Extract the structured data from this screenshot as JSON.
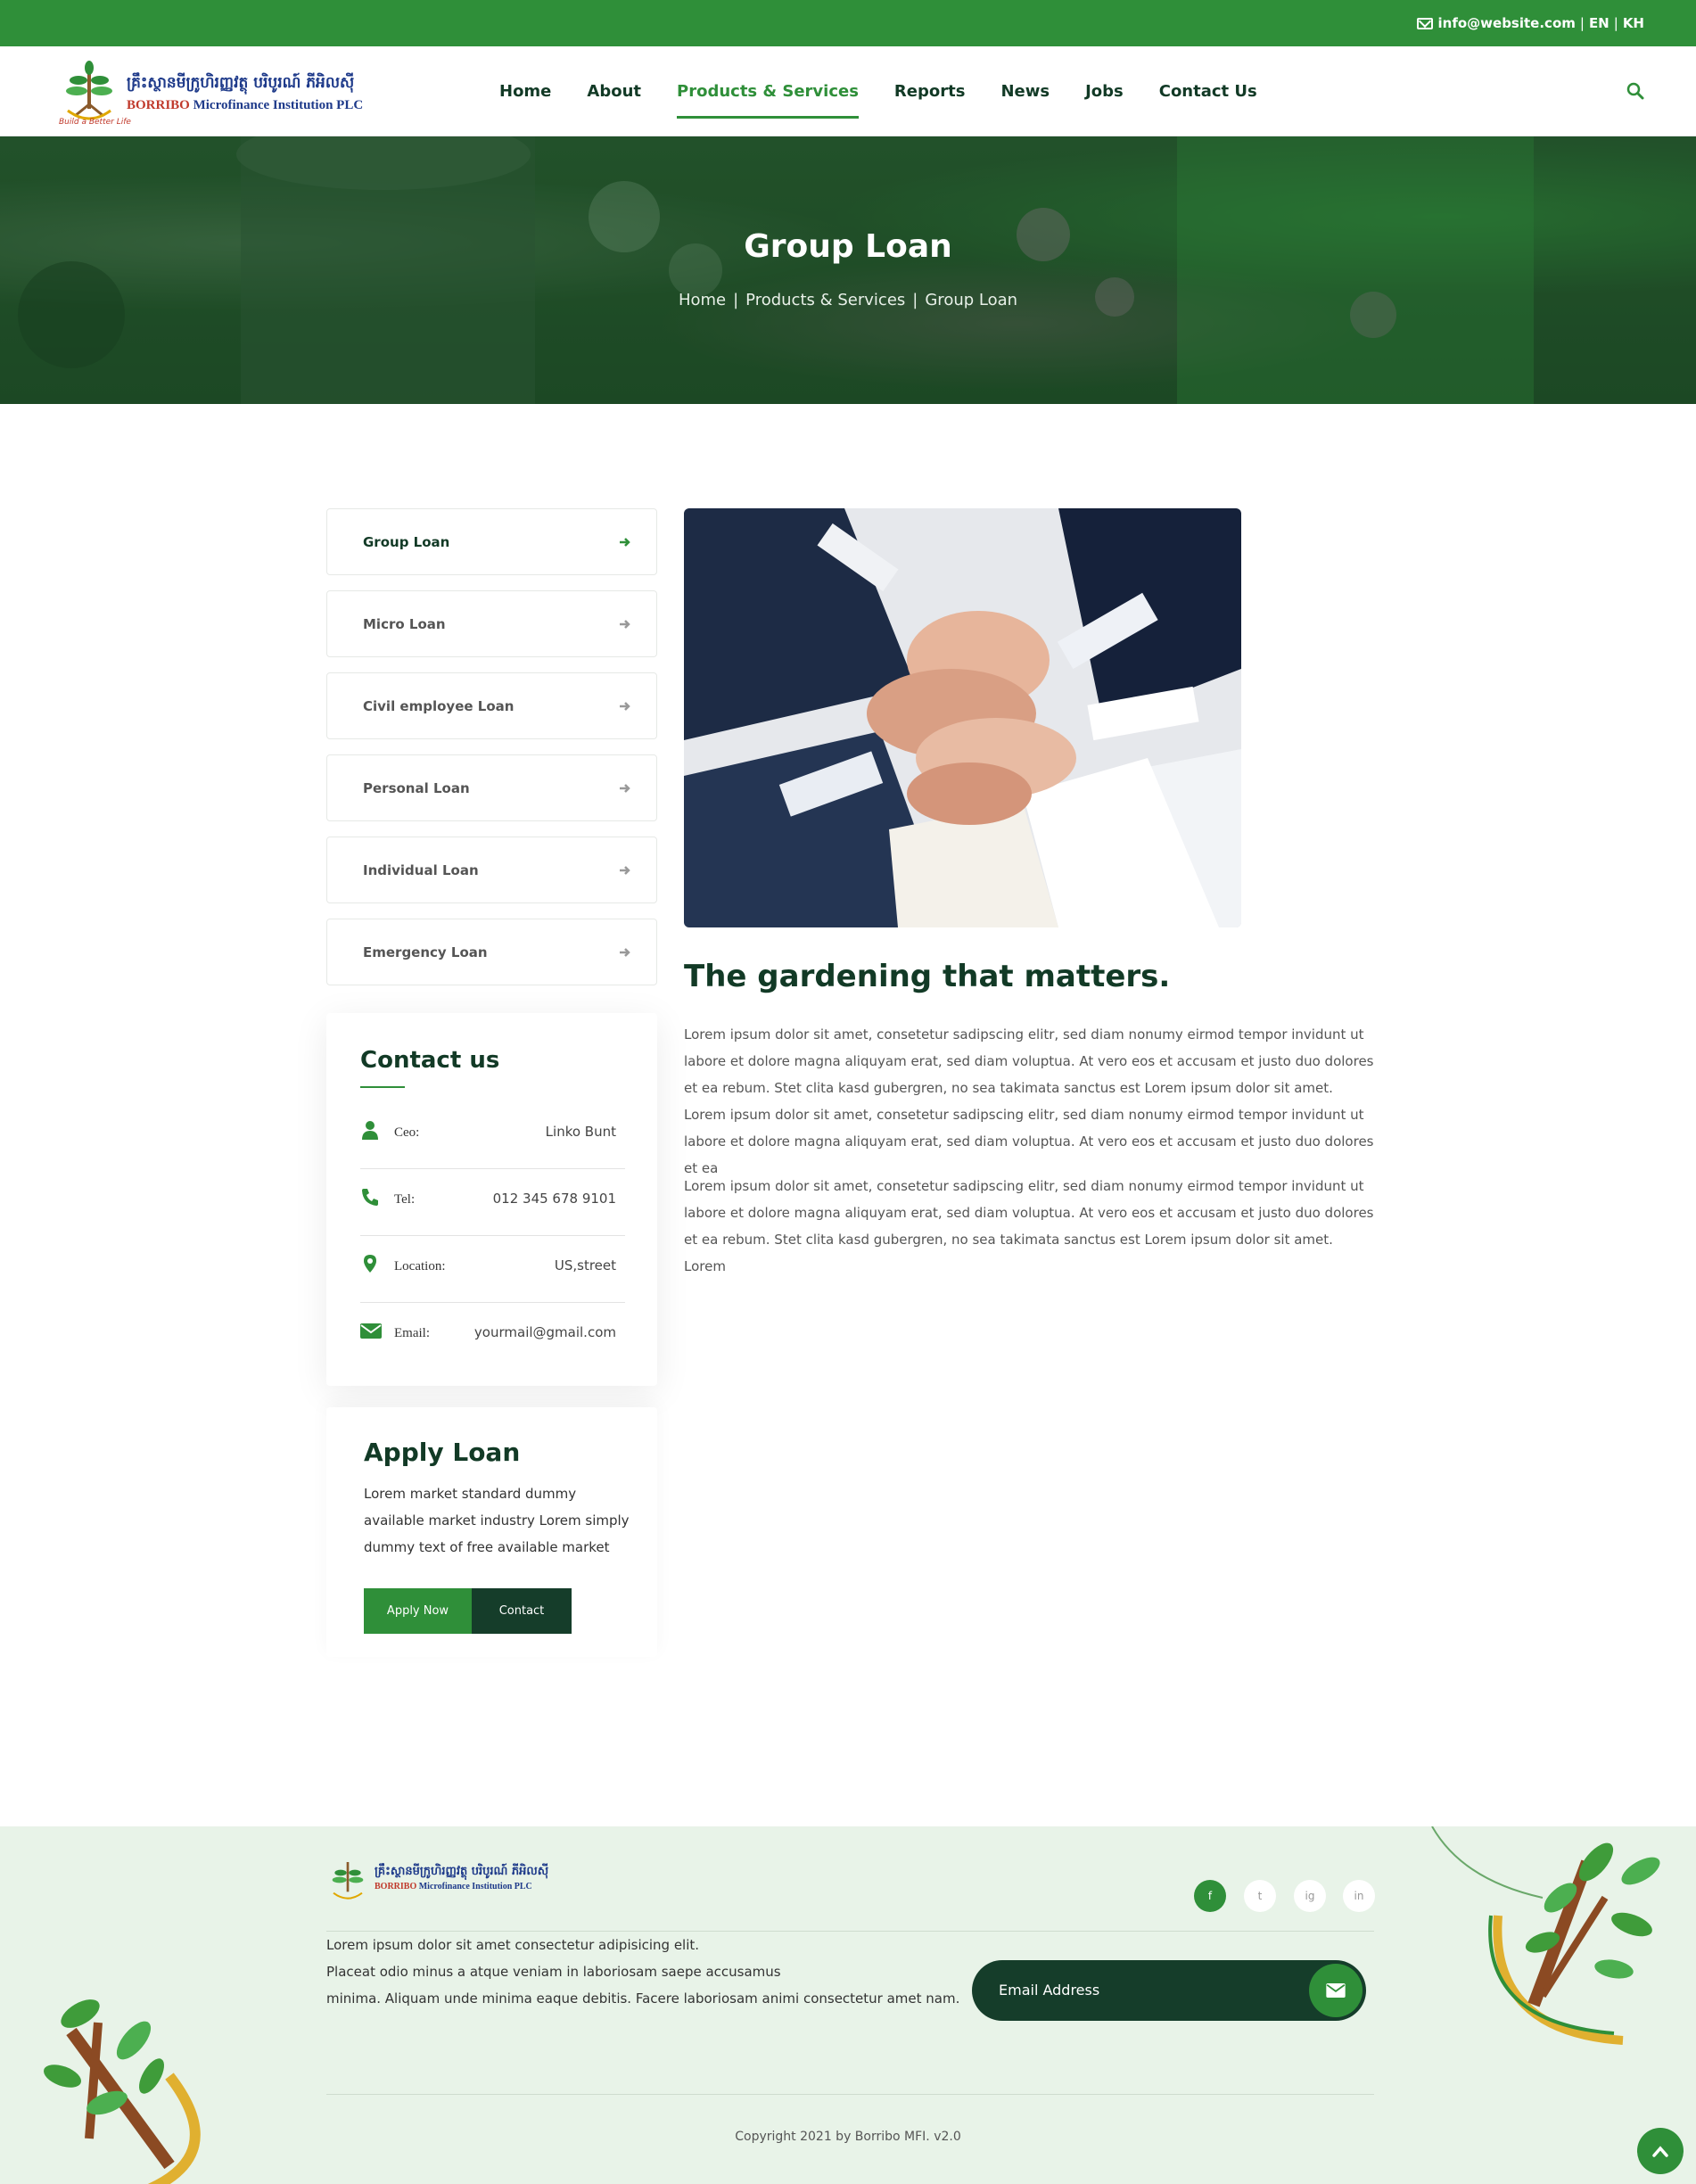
{
  "topbar": {
    "email": "info@website.com",
    "lang_en": "EN",
    "lang_kh": "KH",
    "sep": "|"
  },
  "header": {
    "logo_kh": "គ្រឹះស្ថានមីក្រូហិរញ្ញវត្ថុ បរិបូរណ៍ ភីអិលស៊ី",
    "logo_en_1": "BORRIBO",
    "logo_en_2": "Microfinance Institution PLC",
    "logo_tag": "Build a Better Life",
    "nav": [
      {
        "label": "Home"
      },
      {
        "label": "About"
      },
      {
        "label": "Products & Services"
      },
      {
        "label": "Reports"
      },
      {
        "label": "News"
      },
      {
        "label": "Jobs"
      },
      {
        "label": "Contact Us"
      }
    ]
  },
  "hero": {
    "title": "Group Loan",
    "breadcrumb": [
      "Home",
      "|",
      "Products & Services",
      "|",
      "Group Loan"
    ]
  },
  "sidebar": {
    "items": [
      {
        "label": "Group Loan"
      },
      {
        "label": "Micro Loan"
      },
      {
        "label": "Civil employee Loan"
      },
      {
        "label": "Personal Loan"
      },
      {
        "label": "Individual Loan"
      },
      {
        "label": "Emergency Loan"
      }
    ]
  },
  "contact": {
    "title": "Contact us",
    "rows": [
      {
        "label": "Ceo:",
        "value": "Linko Bunt",
        "icon": "user-icon"
      },
      {
        "label": "Tel:",
        "value": "012 345 678 9101",
        "icon": "phone-icon"
      },
      {
        "label": "Location:",
        "value": "US,street",
        "icon": "map-marker-icon"
      },
      {
        "label": "Email:",
        "value": "yourmail@gmail.com",
        "icon": "envelope-icon"
      }
    ]
  },
  "apply": {
    "title": "Apply Loan",
    "text": "Lorem market standard dummy available market industry Lorem simply dummy text of free available market",
    "apply_button": "Apply Now",
    "contact_button": "Contact"
  },
  "main": {
    "heading": "The gardening that matters.",
    "para1": "Lorem ipsum dolor sit amet, consetetur sadipscing elitr, sed diam nonumy eirmod tempor invidunt ut labore et dolore magna aliquyam erat, sed diam voluptua. At vero eos et accusam et justo duo dolores et ea rebum. Stet clita kasd gubergren, no sea takimata sanctus est Lorem ipsum dolor sit amet. Lorem ipsum dolor sit amet, consetetur sadipscing elitr, sed diam nonumy eirmod tempor invidunt ut labore et dolore magna aliquyam erat, sed diam voluptua. At vero eos et accusam et justo duo dolores et ea",
    "para2": "Lorem ipsum dolor sit amet, consetetur sadipscing elitr, sed diam nonumy eirmod tempor invidunt ut labore et dolore magna aliquyam erat, sed diam voluptua. At vero eos et accusam et justo duo dolores et ea rebum. Stet clita kasd gubergren, no sea takimata sanctus est Lorem ipsum dolor sit amet. Lorem"
  },
  "footer": {
    "logo_kh": "គ្រឹះស្ថានមីក្រូហិរញ្ញវត្ថុ បរិបូរណ៍ ភីអិលស៊ី",
    "logo_en_1": "BORRIBO",
    "logo_en_2": "Microfinance Institution PLC",
    "text_line1": "Lorem ipsum dolor sit amet consectetur adipisicing elit.",
    "text_line2": "Placeat odio minus a atque veniam in laboriosam saepe accusamus",
    "text_line3": "minima. Aliquam unde minima eaque debitis. Facere laboriosam animi consectetur amet nam.",
    "email_placeholder": "Email Address",
    "social": [
      "f",
      "t",
      "ig",
      "in"
    ],
    "copyright": "Copyright 2021 by Borribo MFI. v2.0"
  },
  "colors": {
    "primary": "#2f8f39",
    "dark": "#153d2a",
    "heading": "#123a26",
    "footer_bg": "#e8f3e8"
  }
}
